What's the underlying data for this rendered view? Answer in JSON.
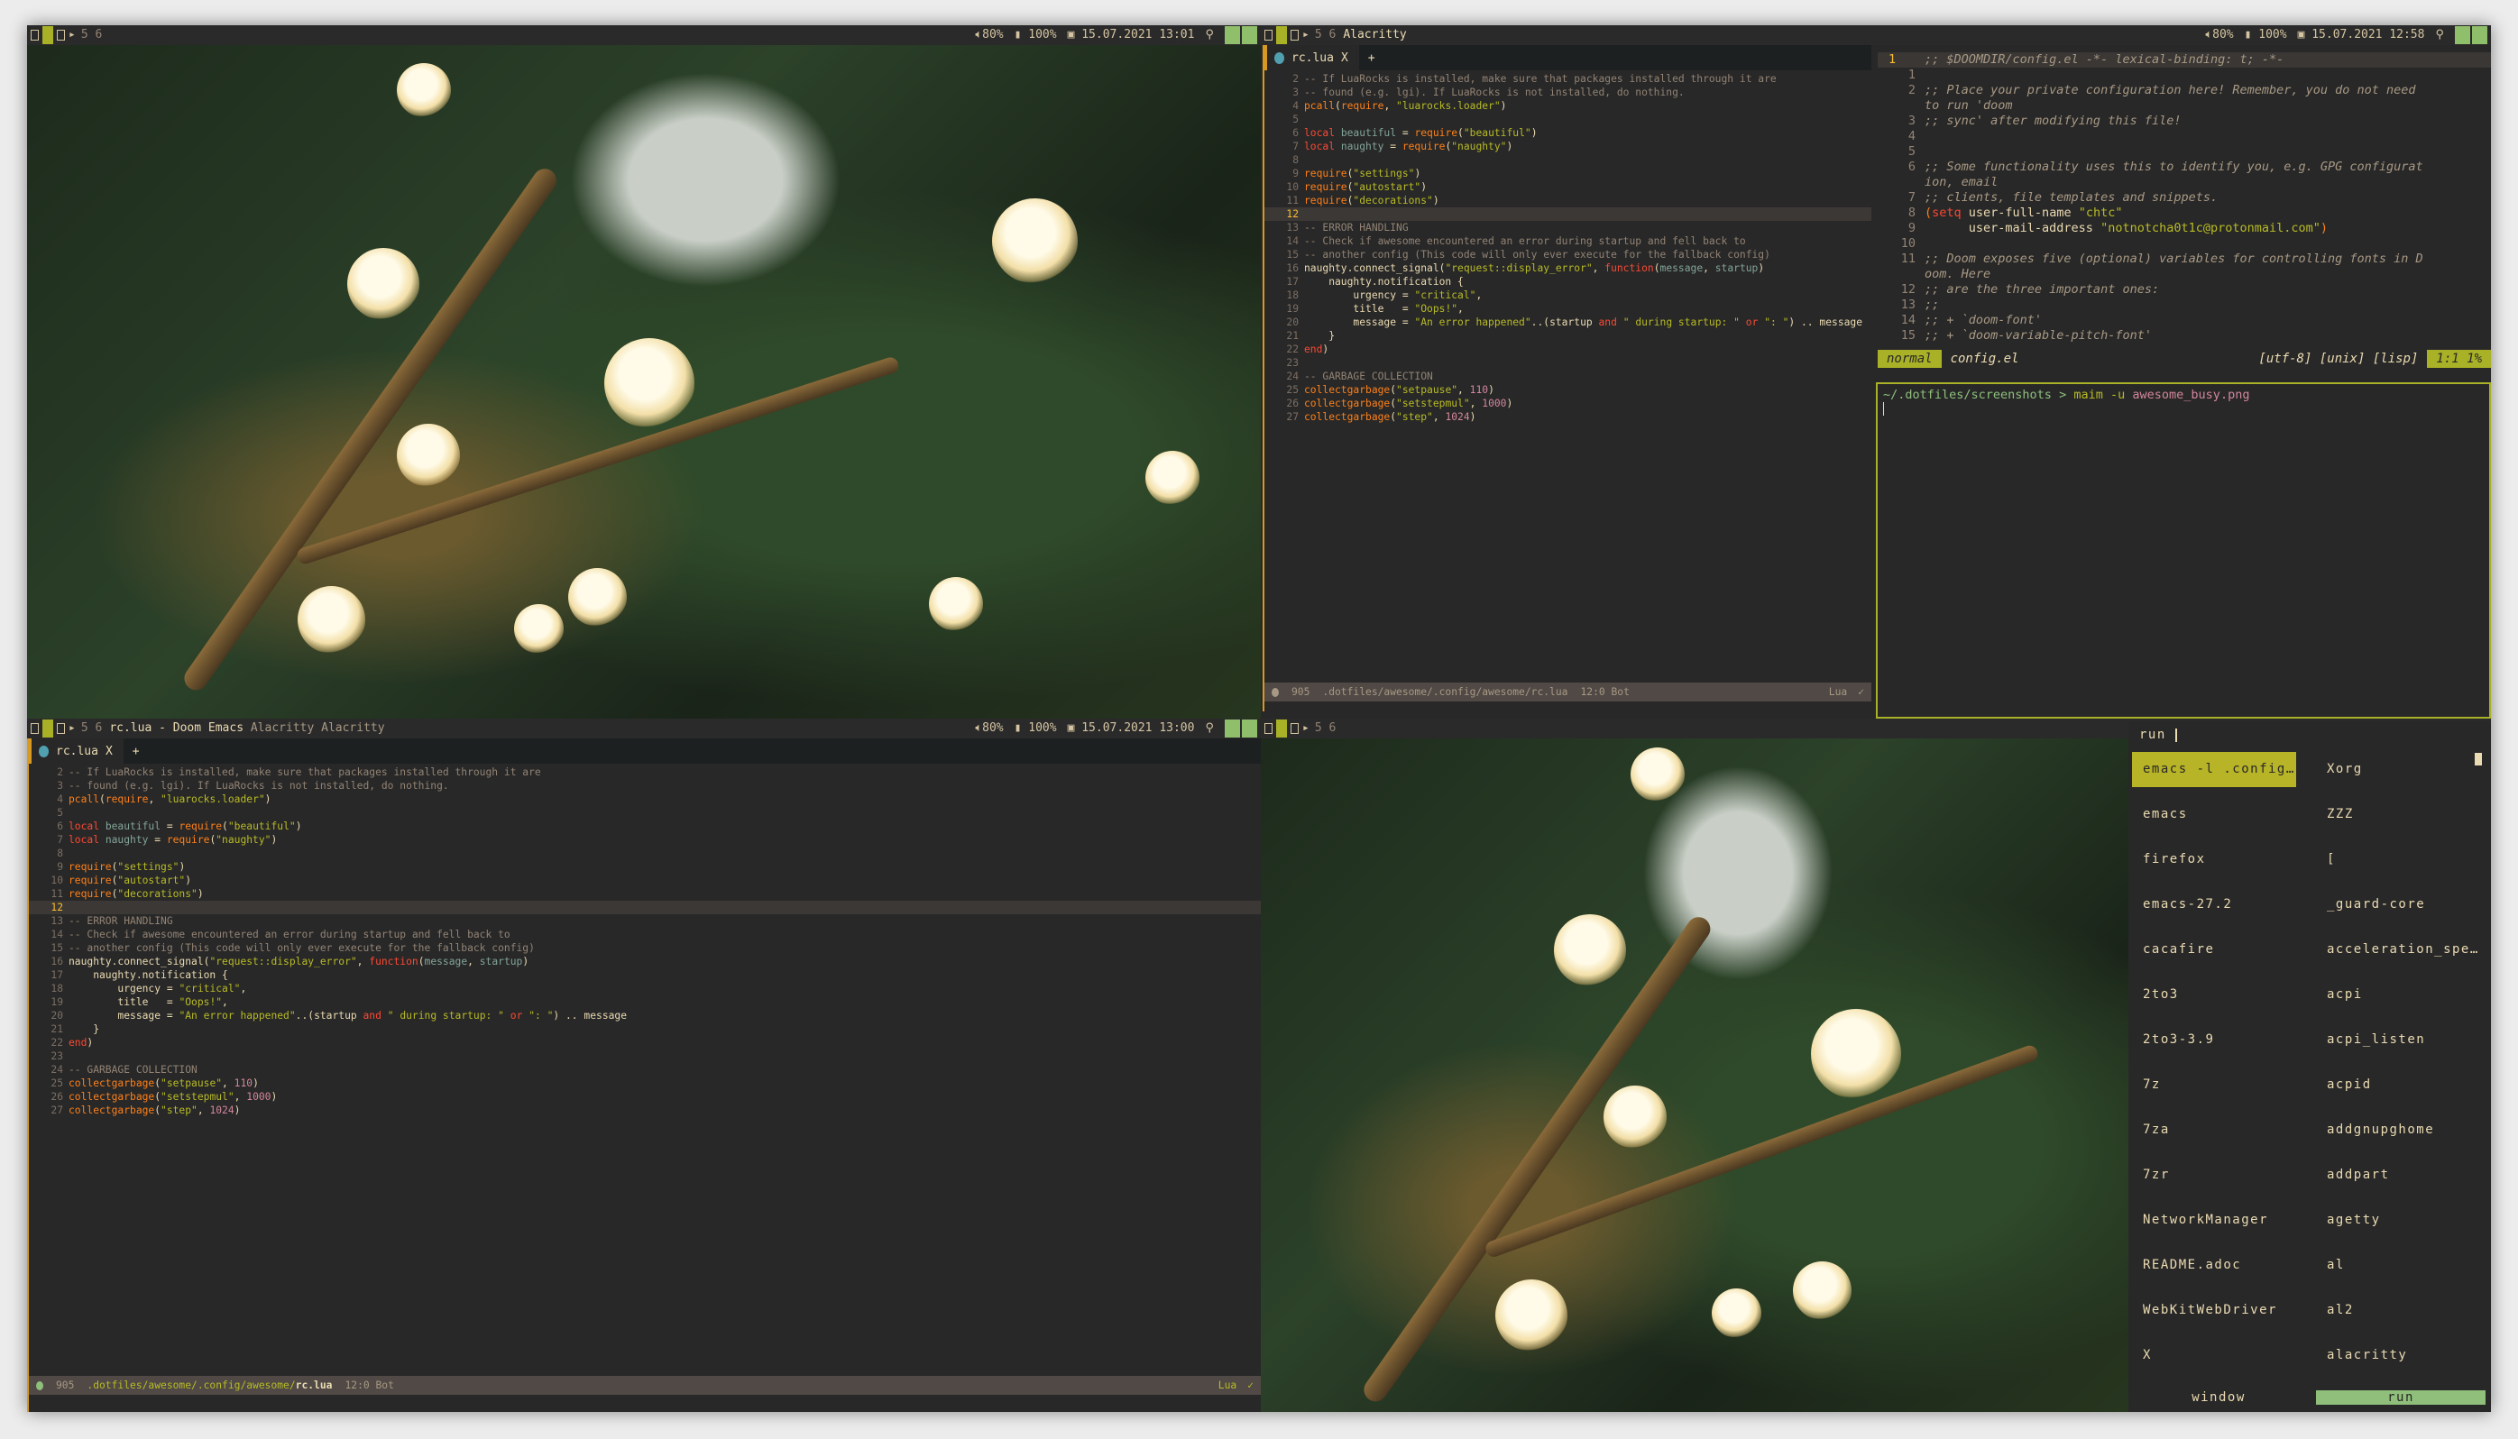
{
  "topbar_left": {
    "tags": "5 6",
    "title": "",
    "volume": "80%",
    "battery": "100%",
    "datetime": "15.07.2021 13:01"
  },
  "topbar_right": {
    "tags": "5 6",
    "title": "Alacritty",
    "volume": "80%",
    "battery": "100%",
    "datetime": "15.07.2021 12:58"
  },
  "bottombar_left": {
    "tags": "5 6",
    "title": "rc.lua - Doom Emacs",
    "title_dim": "Alacritty Alacritty",
    "volume": "80%",
    "battery": "100%",
    "datetime": "15.07.2021 13:00"
  },
  "bottombar_right": {
    "tags": "5 6"
  },
  "editor": {
    "tab_label": "rc.lua",
    "tab_close": "X",
    "new_tab": "+",
    "current_line": 12,
    "lines": [
      {
        "n": "2",
        "t": [
          [
            "c",
            "-- If LuaRocks is installed, make sure that packages installed through it are"
          ]
        ]
      },
      {
        "n": "3",
        "t": [
          [
            "c",
            "-- found (e.g. lgi). If LuaRocks is not installed, do nothing."
          ]
        ]
      },
      {
        "n": "4",
        "t": [
          [
            "f",
            "pcall"
          ],
          [
            "p",
            "("
          ],
          [
            "f",
            "require"
          ],
          [
            "p",
            ", "
          ],
          [
            "s",
            "\"luarocks.loader\""
          ],
          [
            "p",
            ")"
          ]
        ]
      },
      {
        "n": "5",
        "t": []
      },
      {
        "n": "6",
        "t": [
          [
            "k",
            "local "
          ],
          [
            "v",
            "beautiful"
          ],
          [
            "p",
            " = "
          ],
          [
            "f",
            "require"
          ],
          [
            "p",
            "("
          ],
          [
            "s",
            "\"beautiful\""
          ],
          [
            "p",
            ")"
          ]
        ]
      },
      {
        "n": "7",
        "t": [
          [
            "k",
            "local "
          ],
          [
            "v",
            "naughty"
          ],
          [
            "p",
            " = "
          ],
          [
            "f",
            "require"
          ],
          [
            "p",
            "("
          ],
          [
            "s",
            "\"naughty\""
          ],
          [
            "p",
            ")"
          ]
        ]
      },
      {
        "n": "8",
        "t": []
      },
      {
        "n": "9",
        "t": [
          [
            "f",
            "require"
          ],
          [
            "p",
            "("
          ],
          [
            "s",
            "\"settings\""
          ],
          [
            "p",
            ")"
          ]
        ]
      },
      {
        "n": "10",
        "t": [
          [
            "f",
            "require"
          ],
          [
            "p",
            "("
          ],
          [
            "s",
            "\"autostart\""
          ],
          [
            "p",
            ")"
          ]
        ]
      },
      {
        "n": "11",
        "t": [
          [
            "f",
            "require"
          ],
          [
            "p",
            "("
          ],
          [
            "s",
            "\"decorations\""
          ],
          [
            "p",
            ")"
          ]
        ]
      },
      {
        "n": "12",
        "t": []
      },
      {
        "n": "13",
        "t": [
          [
            "c",
            "-- ERROR HANDLING"
          ]
        ]
      },
      {
        "n": "14",
        "t": [
          [
            "c",
            "-- Check if awesome encountered an error during startup and fell back to"
          ]
        ]
      },
      {
        "n": "15",
        "t": [
          [
            "c",
            "-- another config (This code will only ever execute for the fallback config)"
          ]
        ]
      },
      {
        "n": "16",
        "t": [
          [
            "p",
            "naughty.connect_signal("
          ],
          [
            "s",
            "\"request::display_error\""
          ],
          [
            "p",
            ", "
          ],
          [
            "k",
            "function"
          ],
          [
            "p",
            "("
          ],
          [
            "v",
            "message"
          ],
          [
            "p",
            ", "
          ],
          [
            "v",
            "startup"
          ],
          [
            "p",
            ")"
          ]
        ]
      },
      {
        "n": "17",
        "t": [
          [
            "p",
            "    naughty.notification {"
          ]
        ]
      },
      {
        "n": "18",
        "t": [
          [
            "p",
            "        urgency = "
          ],
          [
            "s",
            "\"critical\""
          ],
          [
            "p",
            ","
          ]
        ]
      },
      {
        "n": "19",
        "t": [
          [
            "p",
            "        title   = "
          ],
          [
            "s",
            "\"Oops!\""
          ],
          [
            "p",
            ","
          ]
        ]
      },
      {
        "n": "20",
        "t": [
          [
            "p",
            "        message = "
          ],
          [
            "s",
            "\"An error happened\""
          ],
          [
            "p",
            "..(startup "
          ],
          [
            "k",
            "and"
          ],
          [
            "p",
            " "
          ],
          [
            "s",
            "\" during startup: \""
          ],
          [
            "p",
            " "
          ],
          [
            "k",
            "or"
          ],
          [
            "p",
            " "
          ],
          [
            "s",
            "\": \""
          ],
          [
            "p",
            ") .. message"
          ]
        ]
      },
      {
        "n": "21",
        "t": [
          [
            "p",
            "    }"
          ]
        ]
      },
      {
        "n": "22",
        "t": [
          [
            "k",
            "end"
          ],
          [
            "p",
            ")"
          ]
        ]
      },
      {
        "n": "23",
        "t": []
      },
      {
        "n": "24",
        "t": [
          [
            "c",
            "-- GARBAGE COLLECTION"
          ]
        ]
      },
      {
        "n": "25",
        "t": [
          [
            "f",
            "collectgarbage"
          ],
          [
            "p",
            "("
          ],
          [
            "s",
            "\"setpause\""
          ],
          [
            "p",
            ", "
          ],
          [
            "n",
            "110"
          ],
          [
            "p",
            ")"
          ]
        ]
      },
      {
        "n": "26",
        "t": [
          [
            "f",
            "collectgarbage"
          ],
          [
            "p",
            "("
          ],
          [
            "s",
            "\"setstepmul\""
          ],
          [
            "p",
            ", "
          ],
          [
            "n",
            "1000"
          ],
          [
            "p",
            ")"
          ]
        ]
      },
      {
        "n": "27",
        "t": [
          [
            "f",
            "collectgarbage"
          ],
          [
            "p",
            "("
          ],
          [
            "s",
            "\"step\""
          ],
          [
            "p",
            ", "
          ],
          [
            "n",
            "1024"
          ],
          [
            "p",
            ")"
          ]
        ]
      }
    ],
    "modeline": {
      "lines": "905",
      "path": ".dotfiles/awesome/.config/awesome/",
      "file": "rc.lua",
      "pos": "12:0 Bot",
      "mode": "Lua",
      "check": "✓"
    }
  },
  "doom": {
    "lines": [
      {
        "n": "1",
        "cur": true,
        "t": [
          [
            "c",
            ";; $DOOMDIR/config.el -*- lexical-binding: t; -*-"
          ]
        ]
      },
      {
        "n": "1",
        "t": []
      },
      {
        "n": "2",
        "t": [
          [
            "c",
            ";; Place your private configuration here! Remember, you do not need"
          ]
        ]
      },
      {
        "n": "",
        "t": [
          [
            "c",
            "to run 'doom"
          ]
        ]
      },
      {
        "n": "3",
        "t": [
          [
            "c",
            ";; sync' after modifying this file!"
          ]
        ]
      },
      {
        "n": "4",
        "t": []
      },
      {
        "n": "5",
        "t": []
      },
      {
        "n": "6",
        "t": [
          [
            "c",
            ";; Some functionality uses this to identify you, e.g. GPG configurat"
          ]
        ]
      },
      {
        "n": "",
        "t": [
          [
            "c",
            "ion, email"
          ]
        ]
      },
      {
        "n": "7",
        "t": [
          [
            "c",
            ";; clients, file templates and snippets."
          ]
        ]
      },
      {
        "n": "8",
        "t": [
          [
            "o",
            "("
          ],
          [
            "k",
            "setq"
          ],
          [
            "p",
            " user-full-name "
          ],
          [
            "s",
            "\"chtc\""
          ]
        ]
      },
      {
        "n": "9",
        "t": [
          [
            "p",
            "      user-mail-address "
          ],
          [
            "s",
            "\"notnotcha0t1c@protonmail.com\""
          ],
          [
            "o",
            ")"
          ]
        ]
      },
      {
        "n": "10",
        "t": []
      },
      {
        "n": "11",
        "t": [
          [
            "c",
            ";; Doom exposes five (optional) variables for controlling fonts in D"
          ]
        ]
      },
      {
        "n": "",
        "t": [
          [
            "c",
            "oom. Here"
          ]
        ]
      },
      {
        "n": "12",
        "t": [
          [
            "c",
            ";; are the three important ones:"
          ]
        ]
      },
      {
        "n": "13",
        "t": [
          [
            "c",
            ";;"
          ]
        ]
      },
      {
        "n": "14",
        "t": [
          [
            "c",
            ";; + `doom-font'"
          ]
        ]
      },
      {
        "n": "15",
        "t": [
          [
            "c",
            ";; + `doom-variable-pitch-font'"
          ]
        ]
      }
    ],
    "modeline": {
      "mode": "normal",
      "file": "config.el",
      "encoding": "[utf-8] [unix] [lisp]",
      "pos": "1:1 1%"
    }
  },
  "terminal": {
    "cwd": "~/.dotfiles/screenshots",
    "prompt": ">",
    "cmd": "maim -u",
    "arg": "awesome_busy.png"
  },
  "rofi": {
    "prompt": "run",
    "col1": [
      "emacs -l .config…",
      "emacs",
      "firefox",
      "emacs-27.2",
      "cacafire",
      "2to3",
      "2to3-3.9",
      "7z",
      "7za",
      "7zr",
      "NetworkManager",
      "README.adoc",
      "WebKitWebDriver",
      "X"
    ],
    "col2": [
      "Xorg",
      "ZZZ",
      "[",
      "_guard-core",
      "acceleration_spe…",
      "acpi",
      "acpi_listen",
      "acpid",
      "addgnupghome",
      "addpart",
      "agetty",
      "al",
      "al2",
      "alacritty"
    ],
    "modes": [
      "window",
      "run"
    ],
    "active_mode": "run"
  },
  "colors": {
    "accent": "#a9b126",
    "bg": "#282828",
    "fg": "#ebdbb2",
    "run_active": "#8fbf7a"
  }
}
